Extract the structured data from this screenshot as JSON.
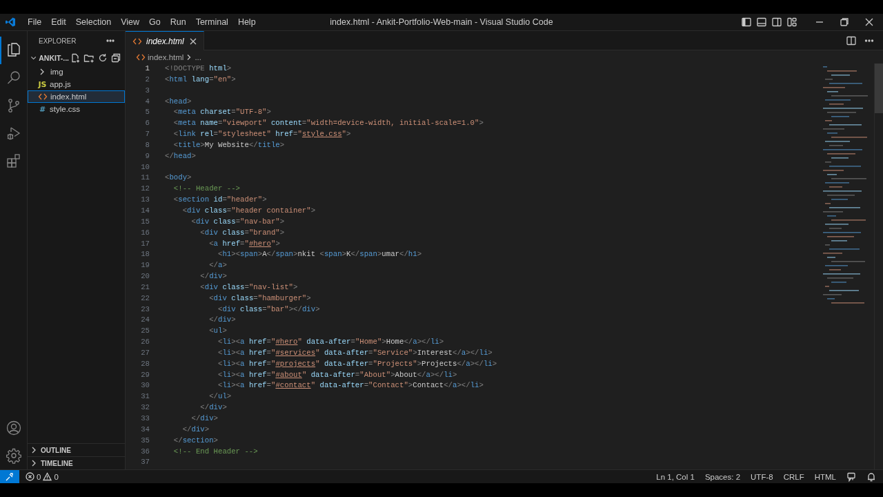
{
  "title_bar": {
    "menu": [
      "File",
      "Edit",
      "Selection",
      "View",
      "Go",
      "Run",
      "Terminal",
      "Help"
    ],
    "title": "index.html - Ankit-Portfolio-Web-main - Visual Studio Code"
  },
  "activity_bar": {
    "items": [
      {
        "kind": "explorer",
        "selected": true
      },
      {
        "kind": "search",
        "selected": false
      },
      {
        "kind": "source-control",
        "selected": false
      },
      {
        "kind": "run",
        "selected": false
      },
      {
        "kind": "extensions",
        "selected": false
      }
    ],
    "bottom": [
      {
        "kind": "accounts"
      },
      {
        "kind": "manage"
      }
    ]
  },
  "sidebar": {
    "title": "EXPLORER",
    "folder": {
      "name": "ANKIT-...",
      "expanded": true
    },
    "items": [
      {
        "kind": "folder",
        "name": "img",
        "expanded": false,
        "selected": false
      },
      {
        "kind": "file",
        "icon": "JS",
        "color": "#cbcb41",
        "name": "app.js",
        "selected": false
      },
      {
        "kind": "html",
        "name": "index.html",
        "selected": true
      },
      {
        "kind": "file",
        "icon": "#",
        "color": "#519aba",
        "name": "style.css",
        "selected": false
      }
    ],
    "sections": [
      {
        "name": "OUTLINE",
        "expanded": false
      },
      {
        "name": "TIMELINE",
        "expanded": false
      }
    ]
  },
  "tabs": [
    {
      "label": "index.html",
      "selected": true,
      "preview": true
    }
  ],
  "breadcrumbs": [
    "index.html",
    "..."
  ],
  "editor": {
    "lines": [
      {
        "n": "1",
        "current": true,
        "parts": [
          {
            "kind": "p",
            "text": "<!DOCTYPE "
          },
          {
            "kind": "attr",
            "text": "html"
          },
          {
            "kind": "p",
            "text": ">"
          }
        ]
      },
      {
        "n": "2",
        "current": false,
        "parts": [
          {
            "kind": "p",
            "text": "<"
          },
          {
            "kind": "tag",
            "text": "html"
          },
          {
            "kind": "attr",
            "text": " lang"
          },
          {
            "kind": "p",
            "text": "="
          },
          {
            "kind": "str",
            "text": "\"en\""
          },
          {
            "kind": "p",
            "text": ">"
          }
        ]
      },
      {
        "n": "3",
        "current": false
      },
      {
        "n": "4",
        "current": false,
        "parts": [
          {
            "kind": "p",
            "text": "<"
          },
          {
            "kind": "tag",
            "text": "head"
          },
          {
            "kind": "p",
            "text": ">"
          }
        ]
      },
      {
        "n": "5",
        "current": false,
        "parts": [
          {
            "kind": "p",
            "text": "  <"
          },
          {
            "kind": "tag",
            "text": "meta"
          },
          {
            "kind": "attr",
            "text": " charset"
          },
          {
            "kind": "p",
            "text": "="
          },
          {
            "kind": "str",
            "text": "\"UTF-8\""
          },
          {
            "kind": "p",
            "text": ">"
          }
        ]
      },
      {
        "n": "6",
        "current": false,
        "parts": [
          {
            "kind": "p",
            "text": "  <"
          },
          {
            "kind": "tag",
            "text": "meta"
          },
          {
            "kind": "attr",
            "text": " name"
          },
          {
            "kind": "p",
            "text": "="
          },
          {
            "kind": "str",
            "text": "\"viewport\""
          },
          {
            "kind": "attr",
            "text": " content"
          },
          {
            "kind": "p",
            "text": "="
          },
          {
            "kind": "str",
            "text": "\"width=device-width, initial-scale=1.0\""
          },
          {
            "kind": "p",
            "text": ">"
          }
        ]
      },
      {
        "n": "7",
        "current": false,
        "parts": [
          {
            "kind": "p",
            "text": "  <"
          },
          {
            "kind": "tag",
            "text": "link"
          },
          {
            "kind": "attr",
            "text": " rel"
          },
          {
            "kind": "p",
            "text": "="
          },
          {
            "kind": "str",
            "text": "\"stylesheet\""
          },
          {
            "kind": "attr",
            "text": " href"
          },
          {
            "kind": "p",
            "text": "="
          },
          {
            "kind": "str",
            "text": "\""
          },
          {
            "kind": "link",
            "text": "style.css"
          },
          {
            "kind": "str",
            "text": "\""
          },
          {
            "kind": "p",
            "text": ">"
          }
        ]
      },
      {
        "n": "8",
        "current": false,
        "parts": [
          {
            "kind": "p",
            "text": "  <"
          },
          {
            "kind": "tag",
            "text": "title"
          },
          {
            "kind": "p",
            "text": ">"
          },
          {
            "kind": "text",
            "text": "My Website"
          },
          {
            "kind": "p",
            "text": "</"
          },
          {
            "kind": "tag",
            "text": "title"
          },
          {
            "kind": "p",
            "text": ">"
          }
        ]
      },
      {
        "n": "9",
        "current": false,
        "parts": [
          {
            "kind": "p",
            "text": "</"
          },
          {
            "kind": "tag",
            "text": "head"
          },
          {
            "kind": "p",
            "text": ">"
          }
        ]
      },
      {
        "n": "10",
        "current": false
      },
      {
        "n": "11",
        "current": false,
        "parts": [
          {
            "kind": "p",
            "text": "<"
          },
          {
            "kind": "tag",
            "text": "body"
          },
          {
            "kind": "p",
            "text": ">"
          }
        ]
      },
      {
        "n": "12",
        "current": false,
        "parts": [
          {
            "kind": "comment",
            "text": "  <!-- Header -->"
          }
        ]
      },
      {
        "n": "13",
        "current": false,
        "parts": [
          {
            "kind": "p",
            "text": "  <"
          },
          {
            "kind": "tag",
            "text": "section"
          },
          {
            "kind": "attr",
            "text": " id"
          },
          {
            "kind": "p",
            "text": "="
          },
          {
            "kind": "str",
            "text": "\"header\""
          },
          {
            "kind": "p",
            "text": ">"
          }
        ]
      },
      {
        "n": "14",
        "current": false,
        "parts": [
          {
            "kind": "p",
            "text": "    <"
          },
          {
            "kind": "tag",
            "text": "div"
          },
          {
            "kind": "attr",
            "text": " class"
          },
          {
            "kind": "p",
            "text": "="
          },
          {
            "kind": "str",
            "text": "\"header container\""
          },
          {
            "kind": "p",
            "text": ">"
          }
        ]
      },
      {
        "n": "15",
        "current": false,
        "parts": [
          {
            "kind": "p",
            "text": "      <"
          },
          {
            "kind": "tag",
            "text": "div"
          },
          {
            "kind": "attr",
            "text": " class"
          },
          {
            "kind": "p",
            "text": "="
          },
          {
            "kind": "str",
            "text": "\"nav-bar\""
          },
          {
            "kind": "p",
            "text": ">"
          }
        ]
      },
      {
        "n": "16",
        "current": false,
        "parts": [
          {
            "kind": "p",
            "text": "        <"
          },
          {
            "kind": "tag",
            "text": "div"
          },
          {
            "kind": "attr",
            "text": " class"
          },
          {
            "kind": "p",
            "text": "="
          },
          {
            "kind": "str",
            "text": "\"brand\""
          },
          {
            "kind": "p",
            "text": ">"
          }
        ]
      },
      {
        "n": "17",
        "current": false,
        "parts": [
          {
            "kind": "p",
            "text": "          <"
          },
          {
            "kind": "tag",
            "text": "a"
          },
          {
            "kind": "attr",
            "text": " href"
          },
          {
            "kind": "p",
            "text": "="
          },
          {
            "kind": "str",
            "text": "\""
          },
          {
            "kind": "link",
            "text": "#hero"
          },
          {
            "kind": "str",
            "text": "\""
          },
          {
            "kind": "p",
            "text": ">"
          }
        ]
      },
      {
        "n": "18",
        "current": false,
        "parts": [
          {
            "kind": "p",
            "text": "            <"
          },
          {
            "kind": "tag",
            "text": "h1"
          },
          {
            "kind": "p",
            "text": "><"
          },
          {
            "kind": "tag",
            "text": "span"
          },
          {
            "kind": "p",
            "text": ">"
          },
          {
            "kind": "text",
            "text": "A"
          },
          {
            "kind": "p",
            "text": "</"
          },
          {
            "kind": "tag",
            "text": "span"
          },
          {
            "kind": "p",
            "text": ">"
          },
          {
            "kind": "text",
            "text": "nkit "
          },
          {
            "kind": "p",
            "text": "<"
          },
          {
            "kind": "tag",
            "text": "span"
          },
          {
            "kind": "p",
            "text": ">"
          },
          {
            "kind": "text",
            "text": "K"
          },
          {
            "kind": "p",
            "text": "</"
          },
          {
            "kind": "tag",
            "text": "span"
          },
          {
            "kind": "p",
            "text": ">"
          },
          {
            "kind": "text",
            "text": "umar"
          },
          {
            "kind": "p",
            "text": "</"
          },
          {
            "kind": "tag",
            "text": "h1"
          },
          {
            "kind": "p",
            "text": ">"
          }
        ]
      },
      {
        "n": "19",
        "current": false,
        "parts": [
          {
            "kind": "p",
            "text": "          </"
          },
          {
            "kind": "tag",
            "text": "a"
          },
          {
            "kind": "p",
            "text": ">"
          }
        ]
      },
      {
        "n": "20",
        "current": false,
        "parts": [
          {
            "kind": "p",
            "text": "        </"
          },
          {
            "kind": "tag",
            "text": "div"
          },
          {
            "kind": "p",
            "text": ">"
          }
        ]
      },
      {
        "n": "21",
        "current": false,
        "parts": [
          {
            "kind": "p",
            "text": "        <"
          },
          {
            "kind": "tag",
            "text": "div"
          },
          {
            "kind": "attr",
            "text": " class"
          },
          {
            "kind": "p",
            "text": "="
          },
          {
            "kind": "str",
            "text": "\"nav-list\""
          },
          {
            "kind": "p",
            "text": ">"
          }
        ]
      },
      {
        "n": "22",
        "current": false,
        "parts": [
          {
            "kind": "p",
            "text": "          <"
          },
          {
            "kind": "tag",
            "text": "div"
          },
          {
            "kind": "attr",
            "text": " class"
          },
          {
            "kind": "p",
            "text": "="
          },
          {
            "kind": "str",
            "text": "\"hamburger\""
          },
          {
            "kind": "p",
            "text": ">"
          }
        ]
      },
      {
        "n": "23",
        "current": false,
        "parts": [
          {
            "kind": "p",
            "text": "            <"
          },
          {
            "kind": "tag",
            "text": "div"
          },
          {
            "kind": "attr",
            "text": " class"
          },
          {
            "kind": "p",
            "text": "="
          },
          {
            "kind": "str",
            "text": "\"bar\""
          },
          {
            "kind": "p",
            "text": "></"
          },
          {
            "kind": "tag",
            "text": "div"
          },
          {
            "kind": "p",
            "text": ">"
          }
        ]
      },
      {
        "n": "24",
        "current": false,
        "parts": [
          {
            "kind": "p",
            "text": "          </"
          },
          {
            "kind": "tag",
            "text": "div"
          },
          {
            "kind": "p",
            "text": ">"
          }
        ]
      },
      {
        "n": "25",
        "current": false,
        "parts": [
          {
            "kind": "p",
            "text": "          <"
          },
          {
            "kind": "tag",
            "text": "ul"
          },
          {
            "kind": "p",
            "text": ">"
          }
        ]
      },
      {
        "n": "26",
        "current": false,
        "parts": [
          {
            "kind": "p",
            "text": "            <"
          },
          {
            "kind": "tag",
            "text": "li"
          },
          {
            "kind": "p",
            "text": "><"
          },
          {
            "kind": "tag",
            "text": "a"
          },
          {
            "kind": "attr",
            "text": " href"
          },
          {
            "kind": "p",
            "text": "="
          },
          {
            "kind": "str",
            "text": "\""
          },
          {
            "kind": "link",
            "text": "#hero"
          },
          {
            "kind": "str",
            "text": "\""
          },
          {
            "kind": "attr",
            "text": " data-after"
          },
          {
            "kind": "p",
            "text": "="
          },
          {
            "kind": "str",
            "text": "\"Home\""
          },
          {
            "kind": "p",
            "text": ">"
          },
          {
            "kind": "text",
            "text": "Home"
          },
          {
            "kind": "p",
            "text": "</"
          },
          {
            "kind": "tag",
            "text": "a"
          },
          {
            "kind": "p",
            "text": "></"
          },
          {
            "kind": "tag",
            "text": "li"
          },
          {
            "kind": "p",
            "text": ">"
          }
        ]
      },
      {
        "n": "27",
        "current": false,
        "parts": [
          {
            "kind": "p",
            "text": "            <"
          },
          {
            "kind": "tag",
            "text": "li"
          },
          {
            "kind": "p",
            "text": "><"
          },
          {
            "kind": "tag",
            "text": "a"
          },
          {
            "kind": "attr",
            "text": " href"
          },
          {
            "kind": "p",
            "text": "="
          },
          {
            "kind": "str",
            "text": "\""
          },
          {
            "kind": "link",
            "text": "#services"
          },
          {
            "kind": "str",
            "text": "\""
          },
          {
            "kind": "attr",
            "text": " data-after"
          },
          {
            "kind": "p",
            "text": "="
          },
          {
            "kind": "str",
            "text": "\"Service\""
          },
          {
            "kind": "p",
            "text": ">"
          },
          {
            "kind": "text",
            "text": "Interest"
          },
          {
            "kind": "p",
            "text": "</"
          },
          {
            "kind": "tag",
            "text": "a"
          },
          {
            "kind": "p",
            "text": "></"
          },
          {
            "kind": "tag",
            "text": "li"
          },
          {
            "kind": "p",
            "text": ">"
          }
        ]
      },
      {
        "n": "28",
        "current": false,
        "parts": [
          {
            "kind": "p",
            "text": "            <"
          },
          {
            "kind": "tag",
            "text": "li"
          },
          {
            "kind": "p",
            "text": "><"
          },
          {
            "kind": "tag",
            "text": "a"
          },
          {
            "kind": "attr",
            "text": " href"
          },
          {
            "kind": "p",
            "text": "="
          },
          {
            "kind": "str",
            "text": "\""
          },
          {
            "kind": "link",
            "text": "#projects"
          },
          {
            "kind": "str",
            "text": "\""
          },
          {
            "kind": "attr",
            "text": " data-after"
          },
          {
            "kind": "p",
            "text": "="
          },
          {
            "kind": "str",
            "text": "\"Projects\""
          },
          {
            "kind": "p",
            "text": ">"
          },
          {
            "kind": "text",
            "text": "Projects"
          },
          {
            "kind": "p",
            "text": "</"
          },
          {
            "kind": "tag",
            "text": "a"
          },
          {
            "kind": "p",
            "text": "></"
          },
          {
            "kind": "tag",
            "text": "li"
          },
          {
            "kind": "p",
            "text": ">"
          }
        ]
      },
      {
        "n": "29",
        "current": false,
        "parts": [
          {
            "kind": "p",
            "text": "            <"
          },
          {
            "kind": "tag",
            "text": "li"
          },
          {
            "kind": "p",
            "text": "><"
          },
          {
            "kind": "tag",
            "text": "a"
          },
          {
            "kind": "attr",
            "text": " href"
          },
          {
            "kind": "p",
            "text": "="
          },
          {
            "kind": "str",
            "text": "\""
          },
          {
            "kind": "link",
            "text": "#about"
          },
          {
            "kind": "str",
            "text": "\""
          },
          {
            "kind": "attr",
            "text": " data-after"
          },
          {
            "kind": "p",
            "text": "="
          },
          {
            "kind": "str",
            "text": "\"About\""
          },
          {
            "kind": "p",
            "text": ">"
          },
          {
            "kind": "text",
            "text": "About"
          },
          {
            "kind": "p",
            "text": "</"
          },
          {
            "kind": "tag",
            "text": "a"
          },
          {
            "kind": "p",
            "text": "></"
          },
          {
            "kind": "tag",
            "text": "li"
          },
          {
            "kind": "p",
            "text": ">"
          }
        ]
      },
      {
        "n": "30",
        "current": false,
        "parts": [
          {
            "kind": "p",
            "text": "            <"
          },
          {
            "kind": "tag",
            "text": "li"
          },
          {
            "kind": "p",
            "text": "><"
          },
          {
            "kind": "tag",
            "text": "a"
          },
          {
            "kind": "attr",
            "text": " href"
          },
          {
            "kind": "p",
            "text": "="
          },
          {
            "kind": "str",
            "text": "\""
          },
          {
            "kind": "link",
            "text": "#contact"
          },
          {
            "kind": "str",
            "text": "\""
          },
          {
            "kind": "attr",
            "text": " data-after"
          },
          {
            "kind": "p",
            "text": "="
          },
          {
            "kind": "str",
            "text": "\"Contact\""
          },
          {
            "kind": "p",
            "text": ">"
          },
          {
            "kind": "text",
            "text": "Contact"
          },
          {
            "kind": "p",
            "text": "</"
          },
          {
            "kind": "tag",
            "text": "a"
          },
          {
            "kind": "p",
            "text": "></"
          },
          {
            "kind": "tag",
            "text": "li"
          },
          {
            "kind": "p",
            "text": ">"
          }
        ]
      },
      {
        "n": "31",
        "current": false,
        "parts": [
          {
            "kind": "p",
            "text": "          </"
          },
          {
            "kind": "tag",
            "text": "ul"
          },
          {
            "kind": "p",
            "text": ">"
          }
        ]
      },
      {
        "n": "32",
        "current": false,
        "parts": [
          {
            "kind": "p",
            "text": "        </"
          },
          {
            "kind": "tag",
            "text": "div"
          },
          {
            "kind": "p",
            "text": ">"
          }
        ]
      },
      {
        "n": "33",
        "current": false,
        "parts": [
          {
            "kind": "p",
            "text": "      </"
          },
          {
            "kind": "tag",
            "text": "div"
          },
          {
            "kind": "p",
            "text": ">"
          }
        ]
      },
      {
        "n": "34",
        "current": false,
        "parts": [
          {
            "kind": "p",
            "text": "    </"
          },
          {
            "kind": "tag",
            "text": "div"
          },
          {
            "kind": "p",
            "text": ">"
          }
        ]
      },
      {
        "n": "35",
        "current": false,
        "parts": [
          {
            "kind": "p",
            "text": "  </"
          },
          {
            "kind": "tag",
            "text": "section"
          },
          {
            "kind": "p",
            "text": ">"
          }
        ]
      },
      {
        "n": "36",
        "current": false,
        "parts": [
          {
            "kind": "comment",
            "text": "  <!-- End Header -->"
          }
        ]
      },
      {
        "n": "37",
        "current": false
      }
    ]
  },
  "status_bar": {
    "errors": "0",
    "warnings": "0",
    "items": [
      "Ln 1, Col 1",
      "Spaces: 2",
      "UTF-8",
      "CRLF",
      "HTML"
    ]
  }
}
